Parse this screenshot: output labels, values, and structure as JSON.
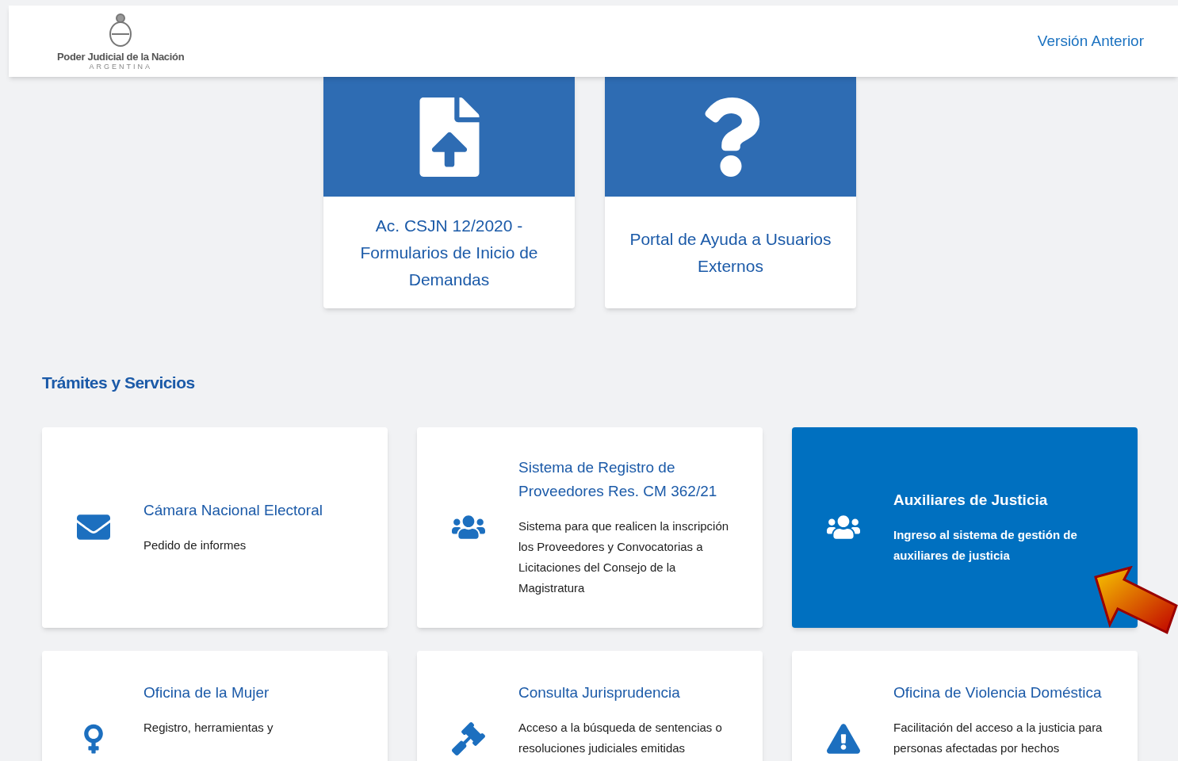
{
  "header": {
    "logo_title": "Poder Judicial de la Nación",
    "logo_subtitle": "ARGENTINA",
    "link": "Versión Anterior"
  },
  "featured": [
    {
      "kind": "upload",
      "title": "Ac. CSJN 12/2020 - Formularios de Inicio de Demandas"
    },
    {
      "kind": "help",
      "title": "Portal de Ayuda a Usuarios Externos"
    }
  ],
  "section_title": "Trámites y Servicios",
  "services": [
    {
      "kind": "mail",
      "title": "Cámara Nacional Electoral",
      "description": "Pedido de informes",
      "highlighted": false
    },
    {
      "kind": "group",
      "title": "Sistema de Registro de Proveedores Res. CM 362/21",
      "description": "Sistema para que realicen la inscripción los Proveedores y Convocatorias a Licitaciones del Consejo de la Magistratura",
      "highlighted": false
    },
    {
      "kind": "group",
      "title": "Auxiliares de Justicia",
      "description": "Ingreso al sistema de gestión de auxiliares de justicia",
      "highlighted": true
    },
    {
      "kind": "women",
      "title": "Oficina de la Mujer",
      "description": "Registro, herramientas y",
      "highlighted": false
    },
    {
      "kind": "law",
      "title": "Consulta Jurisprudencia",
      "description": "Acceso a la búsqueda de sentencias o resoluciones judiciales emitidas",
      "highlighted": false
    },
    {
      "kind": "alert",
      "title": "Oficina de Violencia Doméstica",
      "description": "Facilitación del acceso a la justicia para personas afectadas por hechos",
      "highlighted": false
    }
  ]
}
